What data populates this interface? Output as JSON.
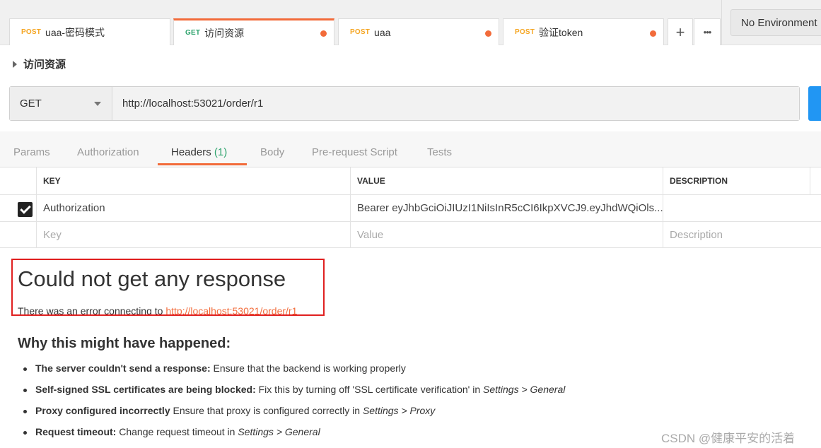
{
  "tabs": [
    {
      "method": "POST",
      "label": "uaa-密码模式",
      "active": false,
      "unsaved": false
    },
    {
      "method": "GET",
      "label": "访问资源",
      "active": true,
      "unsaved": true
    },
    {
      "method": "POST",
      "label": "uaa",
      "active": false,
      "unsaved": true
    },
    {
      "method": "POST",
      "label": "验证token",
      "active": false,
      "unsaved": true
    }
  ],
  "tab_actions": {
    "add_icon": "+",
    "more_icon": "•••"
  },
  "environment": {
    "selected": "No Environment"
  },
  "request": {
    "name": "访问资源",
    "method": "GET",
    "url": "http://localhost:53021/order/r1"
  },
  "subtabs": {
    "params": "Params",
    "authorization": "Authorization",
    "headers": "Headers",
    "headers_count": "(1)",
    "body": "Body",
    "prerequest": "Pre-request Script",
    "tests": "Tests"
  },
  "headers_table": {
    "columns": {
      "key": "KEY",
      "value": "VALUE",
      "description": "DESCRIPTION"
    },
    "rows": [
      {
        "checked": true,
        "key": "Authorization",
        "value": "Bearer eyJhbGciOiJIUzI1NiIsInR5cCI6IkpXVCJ9.eyJhdWQiOls...",
        "description": ""
      }
    ],
    "placeholders": {
      "key": "Key",
      "value": "Value",
      "description": "Description"
    }
  },
  "response": {
    "title": "Could not get any response",
    "subtitle_prefix": "There was an error connecting to",
    "subtitle_link": "http://localhost:53021/order/r1",
    "why_title": "Why this might have happened:",
    "reasons": [
      {
        "bold": "The server couldn't send a response:",
        "text": "Ensure that the backend is working properly",
        "path": ""
      },
      {
        "bold": "Self-signed SSL certificates are being blocked:",
        "text": "Fix this by turning off 'SSL certificate verification' in",
        "path": "Settings > General"
      },
      {
        "bold": "Proxy configured incorrectly",
        "text": "Ensure that proxy is configured correctly in",
        "path": "Settings > Proxy"
      },
      {
        "bold": "Request timeout:",
        "text": "Change request timeout in",
        "path": "Settings > General"
      }
    ]
  },
  "watermark": "CSDN @健康平安的活着",
  "colors": {
    "accent": "#f26b3a",
    "get": "#2da36c",
    "post": "#f5a623",
    "send": "#2196f3",
    "highlight_box": "#e02020"
  }
}
